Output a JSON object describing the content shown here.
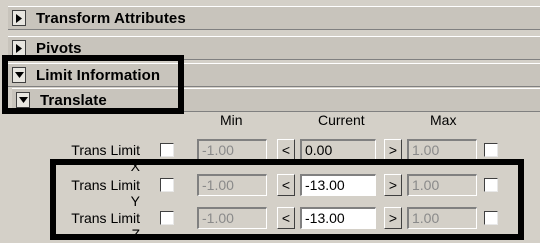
{
  "sections": {
    "transform_attributes": "Transform Attributes",
    "pivots": "Pivots",
    "limit_information": "Limit Information",
    "translate": "Translate"
  },
  "columns": {
    "min": "Min",
    "current": "Current",
    "max": "Max"
  },
  "rows": [
    {
      "label": "Trans Limit X",
      "min": "-1.00",
      "current": "0.00",
      "max": "1.00",
      "enabled": false
    },
    {
      "label": "Trans Limit Y",
      "min": "-1.00",
      "current": "-13.00",
      "max": "1.00",
      "enabled": true
    },
    {
      "label": "Trans Limit Z",
      "min": "-1.00",
      "current": "-13.00",
      "max": "1.00",
      "enabled": true
    }
  ],
  "arrows": {
    "left": "<",
    "right": ">"
  },
  "icons": {
    "collapsed": "triangle-right-icon",
    "expanded": "triangle-down-icon"
  },
  "colors": {
    "background": "#d4d0c8",
    "highlight_border": "#000000",
    "disabled_text": "#8a8a8a"
  }
}
